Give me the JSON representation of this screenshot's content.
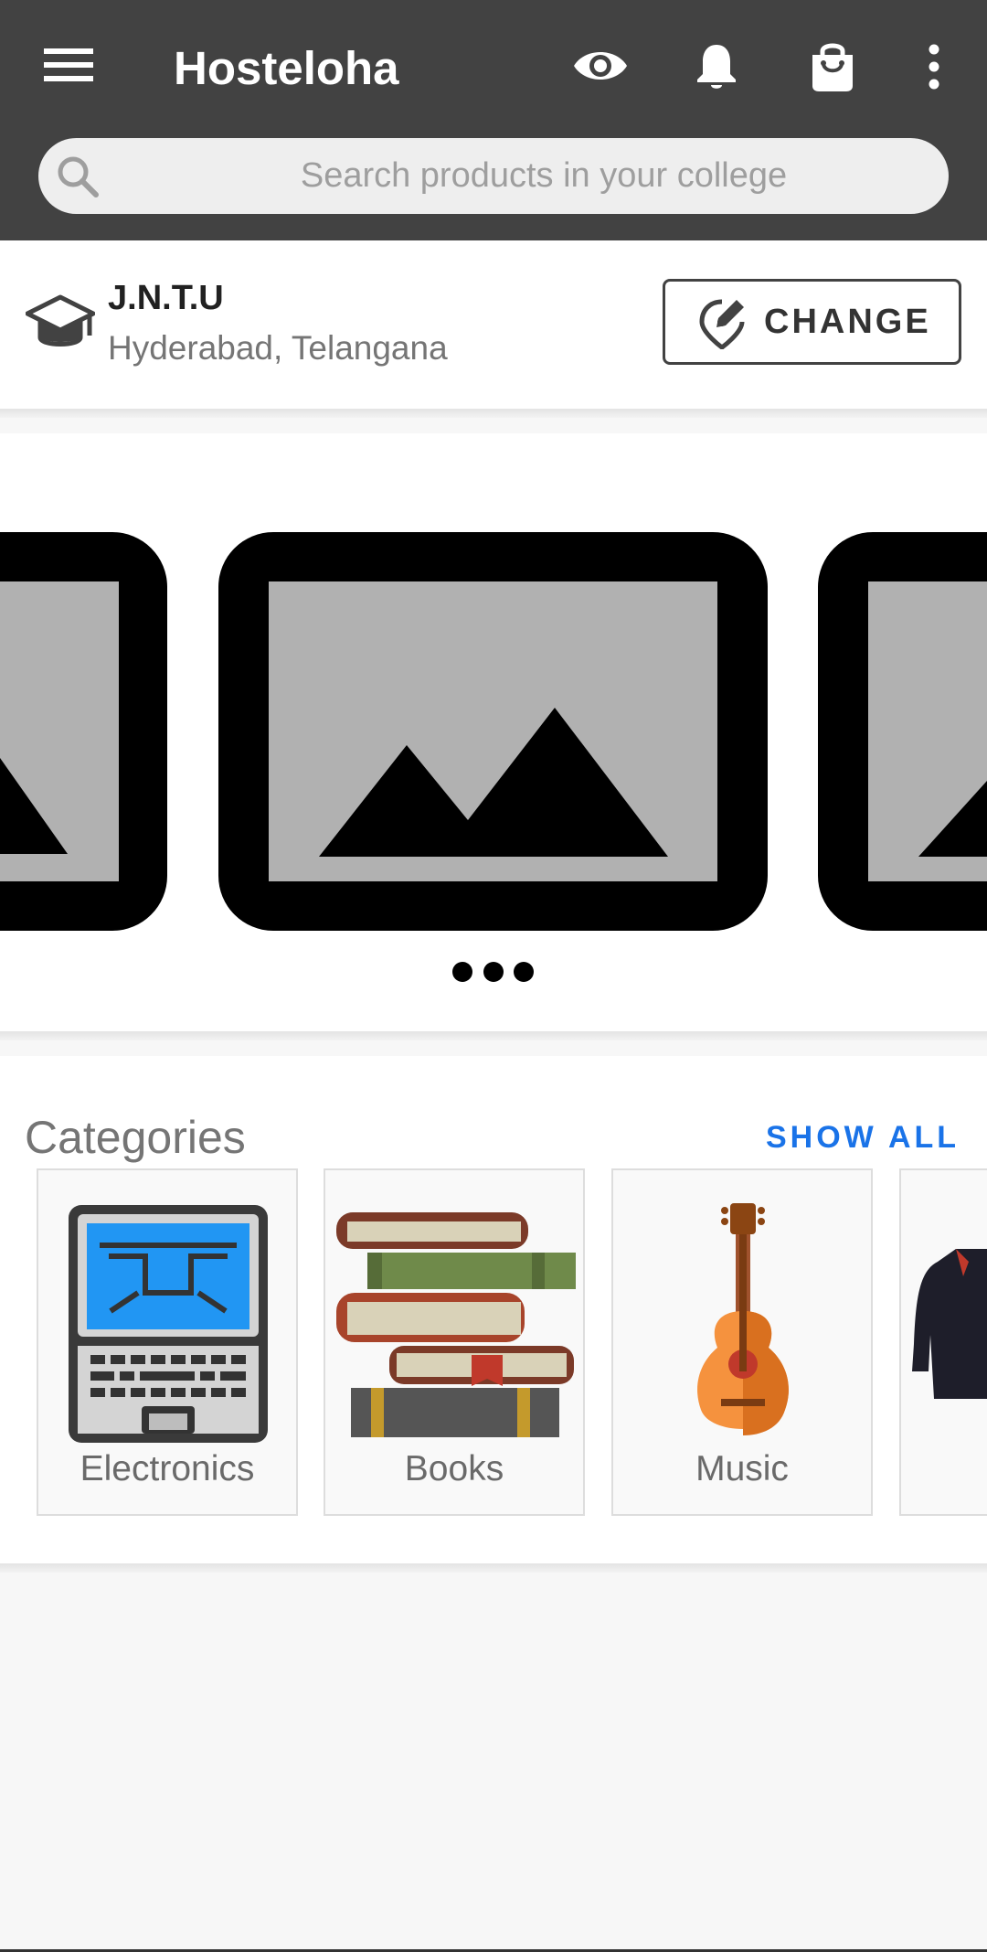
{
  "app": {
    "title": "Hosteloha"
  },
  "toolbar": {
    "menu_icon": "menu-icon",
    "eye_icon": "eye-icon",
    "bell_icon": "bell-icon",
    "bag_icon": "shopping-bag-icon",
    "more_icon": "more-vert-icon"
  },
  "search": {
    "placeholder": "Search products in your college"
  },
  "college": {
    "name": "J.N.T.U",
    "location": "Hyderabad, Telangana",
    "change_label": "CHANGE"
  },
  "banner": {
    "indicator_dots": 3
  },
  "categories": {
    "title": "Categories",
    "show_all_label": "SHOW ALL",
    "items": [
      {
        "label": "Electronics",
        "icon": "laptop-icon"
      },
      {
        "label": "Books",
        "icon": "books-icon"
      },
      {
        "label": "Music",
        "icon": "guitar-icon"
      },
      {
        "label": "",
        "icon": "jacket-icon"
      }
    ]
  },
  "colors": {
    "appbar": "#424242",
    "accent": "#1a73e8",
    "background": "#f7f7f7"
  }
}
